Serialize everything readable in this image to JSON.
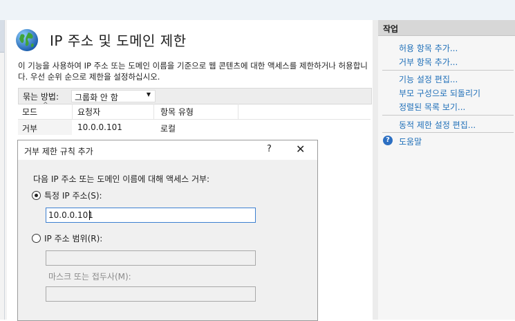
{
  "page": {
    "title": "IP 주소 및 도메인 제한",
    "description": "이 기능을 사용하여 IP 주소 또는 도메인 이름을 기준으로 웹 콘텐츠에 대한 액세스를 제한하거나 허용합니다. 우선 순위 순으로 제한을 설정하십시오."
  },
  "grouping": {
    "label": "묶는 방법:",
    "value": "그룹화 안 함"
  },
  "table": {
    "headers": [
      "모드",
      "요청자",
      "항목 유형"
    ],
    "rows": [
      {
        "mode": "거부",
        "requester": "10.0.0.101",
        "type": "로컬"
      }
    ]
  },
  "dialog": {
    "title": "거부 제한 규칙 추가",
    "help_glyph": "?",
    "close_glyph": "✕",
    "prompt": "다음 IP 주소 또는 도메인 이름에 대해 액세스 거부:",
    "specific_ip_label": "특정 IP 주소(S):",
    "specific_ip_value": "10.0.0.101",
    "range_label": "IP 주소 범위(R):",
    "range_value": "",
    "mask_label": "마스크 또는 접두사(M):",
    "mask_value": ""
  },
  "actions": {
    "header": "작업",
    "group1": [
      "허용 항목 추가...",
      "거부 항목 추가..."
    ],
    "group2": [
      "기능 설정 편집...",
      "부모 구성으로 되돌리기",
      "정렬된 목록 보기..."
    ],
    "group3": [
      "동적 제한 설정 편집..."
    ],
    "help": "도움말"
  },
  "icons": {
    "globe": "globe-icon",
    "help": "help-icon",
    "dropdown": "chevron-down-icon",
    "sort": "sort-up-icon"
  },
  "colors": {
    "link": "#1f6fb8",
    "accent_border": "#3c7fd0"
  }
}
